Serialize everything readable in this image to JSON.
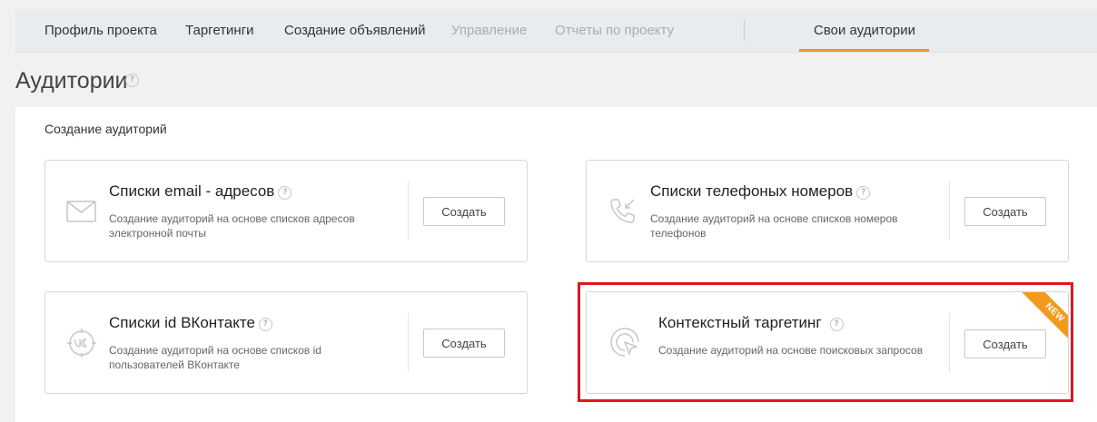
{
  "nav": {
    "items": [
      {
        "label": "Профиль проекта",
        "state": "normal"
      },
      {
        "label": "Таргетинги",
        "state": "normal"
      },
      {
        "label": "Создание объявлений",
        "state": "normal"
      },
      {
        "label": "Управление",
        "state": "disabled"
      },
      {
        "label": "Отчеты по проекту",
        "state": "disabled"
      },
      {
        "label": "Свои аудитории",
        "state": "active"
      }
    ],
    "active_color": "#f0922a"
  },
  "page": {
    "title": "Аудитории",
    "help_glyph": "?"
  },
  "section": {
    "title": "Создание аудиторий"
  },
  "cards": [
    {
      "icon": "envelope-icon",
      "title": "Списки email - адресов",
      "help_glyph": "?",
      "description": "Создание аудиторий на основе списков адресов электронной почты",
      "button_label": "Создать"
    },
    {
      "icon": "phone-icon",
      "title": "Списки телефоных номеров",
      "help_glyph": "?",
      "description": "Создание аудиторий на основе списков номеров телефонов",
      "button_label": "Создать"
    },
    {
      "icon": "vk-icon",
      "title": "Списки id ВКонтакте",
      "help_glyph": "?",
      "description": "Создание аудиторий на основе списков id пользователей ВКонтакте",
      "button_label": "Создать"
    },
    {
      "icon": "target-cursor-icon",
      "title": "Контекстный таргетинг",
      "help_glyph": "?",
      "description": "Создание аудиторий на основе поисковых запросов",
      "button_label": "Создать",
      "badge": "NEW"
    }
  ],
  "colors": {
    "highlight": "#e0151d",
    "badge": "#f39a1e"
  }
}
